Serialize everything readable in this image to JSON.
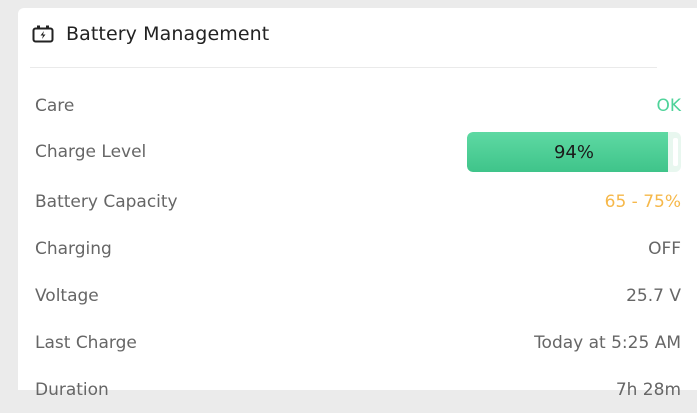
{
  "header": {
    "title": "Battery Management",
    "icon": "battery-charging-icon"
  },
  "colors": {
    "ok": "#4fd39a",
    "warning": "#f6b84a",
    "progress": "#3fc48a"
  },
  "rows": [
    {
      "label": "Care",
      "value": "OK"
    },
    {
      "label": "Charge Level",
      "value": "94%",
      "level": 0.94
    },
    {
      "label": "Battery Capacity",
      "value": "65 - 75%"
    },
    {
      "label": "Charging",
      "value": "OFF"
    },
    {
      "label": "Voltage",
      "value": "25.7 V"
    },
    {
      "label": "Last Charge",
      "value": "Today at 5:25 AM"
    },
    {
      "label": "Duration",
      "value": "7h 28m"
    }
  ]
}
